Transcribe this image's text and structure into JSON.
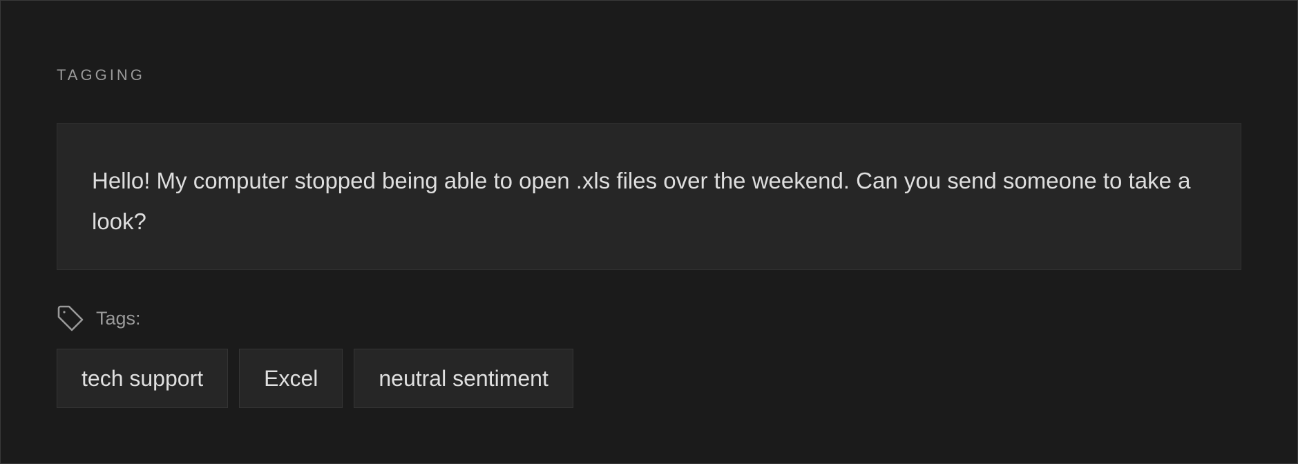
{
  "section": {
    "label": "TAGGING"
  },
  "message": {
    "text": "Hello! My computer stopped being able to open .xls files over the weekend. Can you send someone to take a look?"
  },
  "tags": {
    "icon": "tag-icon",
    "label": "Tags:",
    "items": [
      {
        "label": "tech support"
      },
      {
        "label": "Excel"
      },
      {
        "label": "neutral sentiment"
      }
    ]
  },
  "colors": {
    "background": "#1b1b1b",
    "panel": "#262626",
    "text_primary": "#dedede",
    "text_muted": "#9a9a9a"
  }
}
